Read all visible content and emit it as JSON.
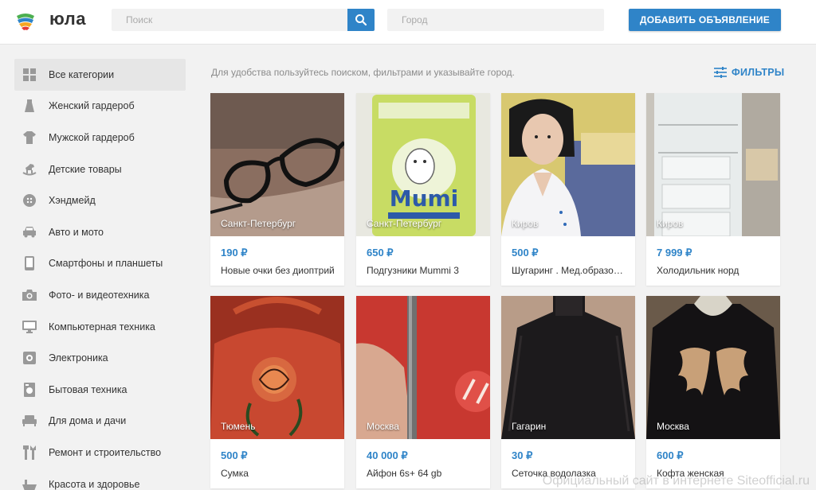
{
  "header": {
    "logo_text": "юла",
    "search_placeholder": "Поиск",
    "city_placeholder": "Город",
    "add_button": "ДОБАВИТЬ ОБЪЯВЛЕНИЕ"
  },
  "sidebar": {
    "items": [
      {
        "label": "Все категории",
        "icon": "grid-icon"
      },
      {
        "label": "Женский гардероб",
        "icon": "dress-icon"
      },
      {
        "label": "Мужской гардероб",
        "icon": "shirt-icon"
      },
      {
        "label": "Детские товары",
        "icon": "rocking-horse-icon"
      },
      {
        "label": "Хэндмейд",
        "icon": "button-icon"
      },
      {
        "label": "Авто и мото",
        "icon": "car-icon"
      },
      {
        "label": "Смартфоны и планшеты",
        "icon": "smartphone-icon"
      },
      {
        "label": "Фото- и видеотехника",
        "icon": "camera-icon"
      },
      {
        "label": "Компьютерная техника",
        "icon": "monitor-icon"
      },
      {
        "label": "Электроника",
        "icon": "speaker-icon"
      },
      {
        "label": "Бытовая техника",
        "icon": "washing-machine-icon"
      },
      {
        "label": "Для дома и дачи",
        "icon": "sofa-icon"
      },
      {
        "label": "Ремонт и строительство",
        "icon": "tools-icon"
      },
      {
        "label": "Красота и здоровье",
        "icon": "beauty-icon"
      }
    ]
  },
  "main": {
    "hint": "Для удобства пользуйтесь поиском, фильтрами и указывайте город.",
    "filters_label": "ФИЛЬТРЫ",
    "cards": [
      {
        "city": "Санкт-Петербург",
        "price": "190 ₽",
        "title": "Новые очки без диоптрий"
      },
      {
        "city": "Санкт-Петербург",
        "price": "650 ₽",
        "title": "Подгузники Mummi 3"
      },
      {
        "city": "Киров",
        "price": "500 ₽",
        "title": "Шугаринг . Мед.образование"
      },
      {
        "city": "Киров",
        "price": "7 999 ₽",
        "title": "Холодильник норд"
      },
      {
        "city": "Тюмень",
        "price": "500 ₽",
        "title": "Сумка"
      },
      {
        "city": "Москва",
        "price": "40 000 ₽",
        "title": "Айфон 6s+ 64 gb"
      },
      {
        "city": "Гагарин",
        "price": "30 ₽",
        "title": "Сеточка водолазка"
      },
      {
        "city": "Москва",
        "price": "600 ₽",
        "title": "Кофта женская"
      }
    ]
  },
  "watermark": "Официальный сайт в интернете Siteofficial.ru",
  "colors": {
    "accent": "#2f84c8",
    "page_bg": "#f2f2f2"
  }
}
